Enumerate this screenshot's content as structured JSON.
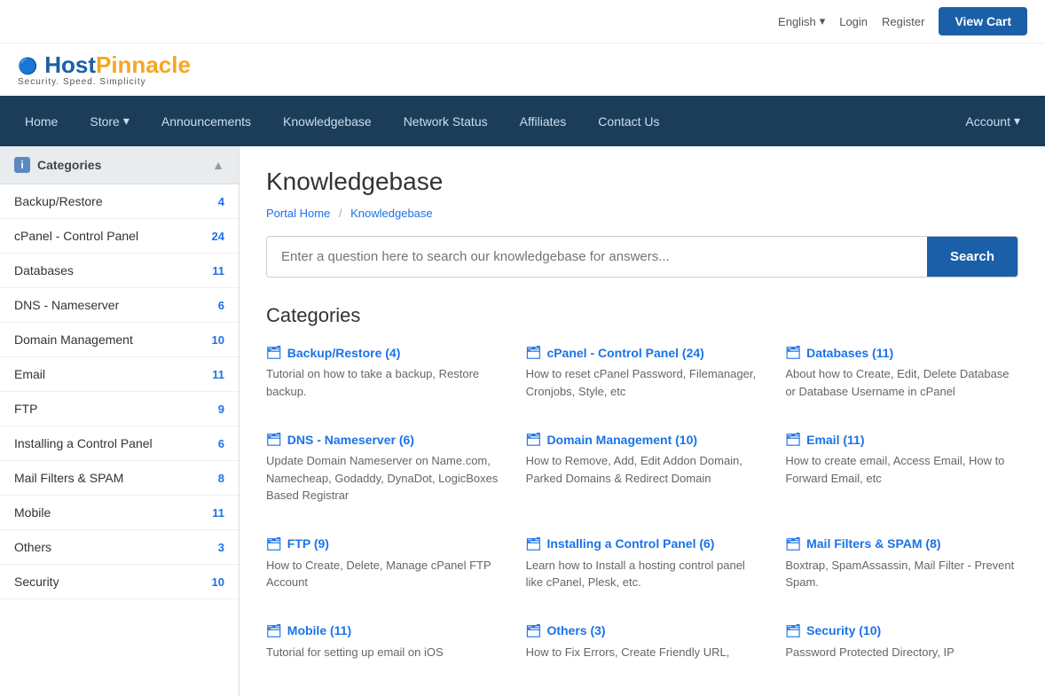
{
  "topbar": {
    "language": "English",
    "language_arrow": "▾",
    "login": "Login",
    "register": "Register",
    "view_cart": "View Cart"
  },
  "logo": {
    "text_host": "Host",
    "text_pinnacle": "Pinnacle",
    "icon_dots": "···○○",
    "tagline": "Security. Speed. Simplicity"
  },
  "navbar": {
    "items": [
      {
        "label": "Home",
        "active": false
      },
      {
        "label": "Store",
        "has_arrow": true
      },
      {
        "label": "Announcements",
        "has_arrow": false
      },
      {
        "label": "Knowledgebase",
        "has_arrow": false
      },
      {
        "label": "Network Status",
        "has_arrow": false
      },
      {
        "label": "Affiliates",
        "has_arrow": false
      },
      {
        "label": "Contact Us",
        "has_arrow": false
      }
    ],
    "account_label": "Account",
    "account_arrow": "▾"
  },
  "sidebar": {
    "header": "Categories",
    "items": [
      {
        "name": "Backup/Restore",
        "count": "4"
      },
      {
        "name": "cPanel - Control Panel",
        "count": "24"
      },
      {
        "name": "Databases",
        "count": "11"
      },
      {
        "name": "DNS - Nameserver",
        "count": "6"
      },
      {
        "name": "Domain Management",
        "count": "10"
      },
      {
        "name": "Email",
        "count": "11"
      },
      {
        "name": "FTP",
        "count": "9"
      },
      {
        "name": "Installing a Control Panel",
        "count": "6"
      },
      {
        "name": "Mail Filters & SPAM",
        "count": "8"
      },
      {
        "name": "Mobile",
        "count": "11"
      },
      {
        "name": "Others",
        "count": "3"
      },
      {
        "name": "Security",
        "count": "10"
      }
    ]
  },
  "content": {
    "page_title": "Knowledgebase",
    "breadcrumb_home": "Portal Home",
    "breadcrumb_sep": "/",
    "breadcrumb_current": "Knowledgebase",
    "search_placeholder": "Enter a question here to search our knowledgebase for answers...",
    "search_btn": "Search",
    "categories_title": "Categories",
    "categories": [
      {
        "title": "Backup/Restore (4)",
        "desc": "Tutorial on how to take a backup, Restore backup."
      },
      {
        "title": "cPanel - Control Panel (24)",
        "desc": "How to reset cPanel Password, Filemanager, Cronjobs, Style, etc"
      },
      {
        "title": "Databases (11)",
        "desc": "About how to Create, Edit, Delete Database or Database Username in cPanel"
      },
      {
        "title": "DNS - Nameserver (6)",
        "desc": "Update Domain Nameserver on Name.com, Namecheap, Godaddy, DynaDot, LogicBoxes Based Registrar"
      },
      {
        "title": "Domain Management (10)",
        "desc": "How to Remove, Add, Edit Addon Domain, Parked Domains & Redirect Domain"
      },
      {
        "title": "Email (11)",
        "desc": "How to create email, Access Email, How to Forward Email, etc"
      },
      {
        "title": "FTP (9)",
        "desc": "How to Create, Delete, Manage cPanel FTP Account"
      },
      {
        "title": "Installing a Control Panel (6)",
        "desc": "Learn how to Install a hosting control panel like cPanel, Plesk, etc."
      },
      {
        "title": "Mail Filters & SPAM (8)",
        "desc": "Boxtrap, SpamAssassin, Mail Filter - Prevent Spam."
      },
      {
        "title": "Mobile (11)",
        "desc": "Tutorial for setting up email on iOS"
      },
      {
        "title": "Others (3)",
        "desc": "How to Fix Errors, Create Friendly URL,"
      },
      {
        "title": "Security (10)",
        "desc": "Password Protected Directory, IP"
      }
    ]
  }
}
